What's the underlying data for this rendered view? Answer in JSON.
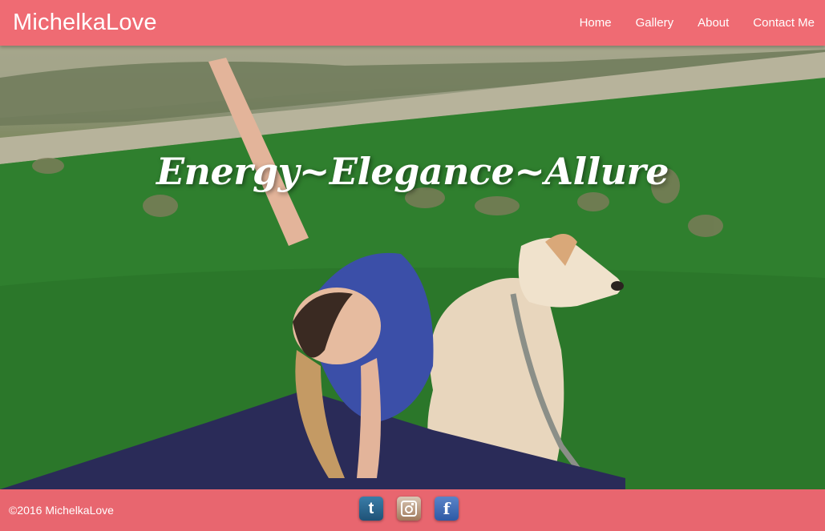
{
  "header": {
    "brand": "MichelkaLove",
    "nav": [
      {
        "label": "Home"
      },
      {
        "label": "Gallery"
      },
      {
        "label": "About"
      },
      {
        "label": "Contact Me"
      }
    ]
  },
  "hero": {
    "title": "Energy~Elegance~Allure"
  },
  "footer": {
    "copyright": "©2016 MichelkaLove",
    "social": [
      {
        "icon": "tumblr-icon",
        "glyph": "t"
      },
      {
        "icon": "instagram-icon",
        "glyph": ""
      },
      {
        "icon": "facebook-icon",
        "glyph": "f"
      }
    ]
  },
  "colors": {
    "header": "#ef6b73",
    "footer": "#e8666f",
    "text": "#ffffff"
  }
}
